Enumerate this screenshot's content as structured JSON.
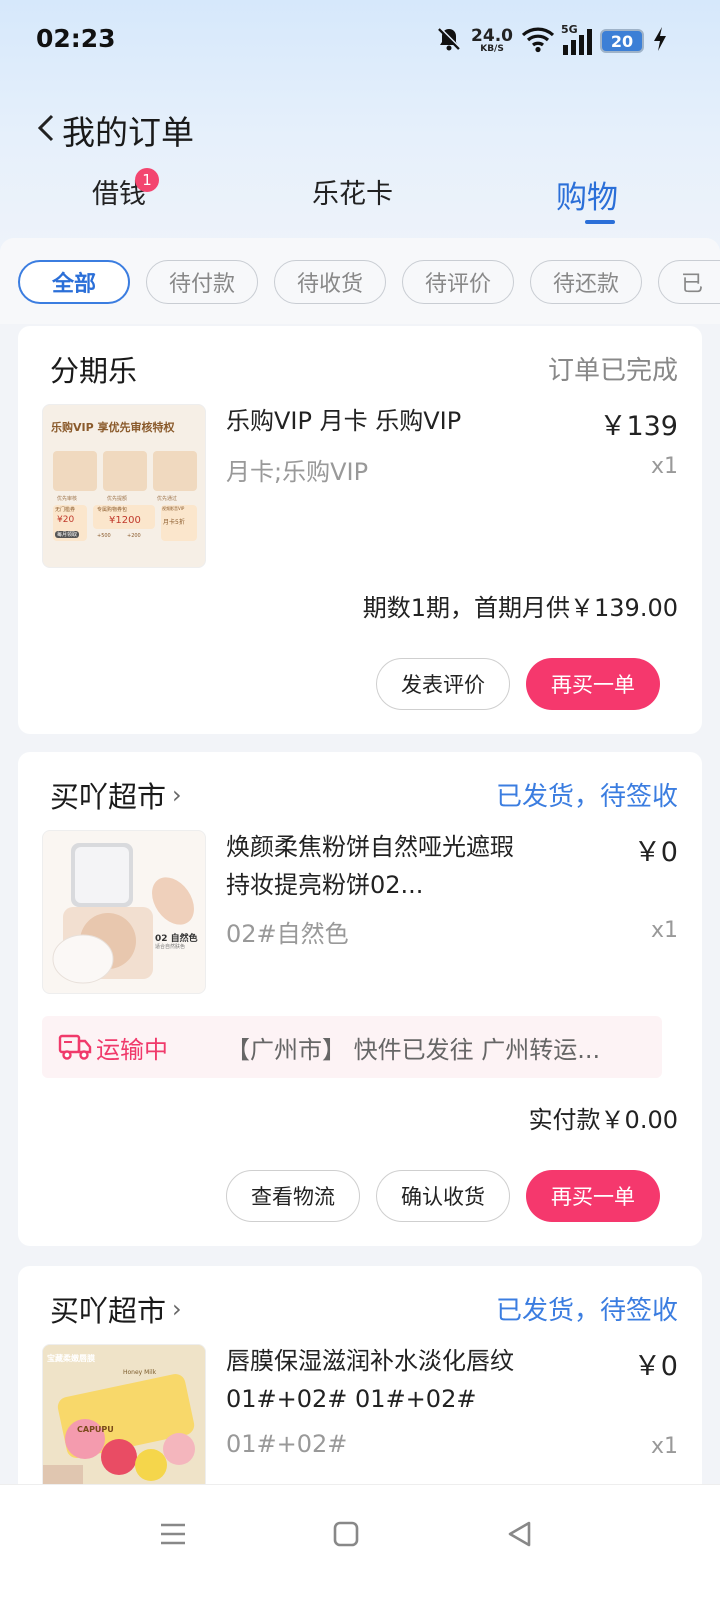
{
  "status_bar": {
    "time": "02:23",
    "net_speed_value": "24.0",
    "net_speed_unit": "KB/S",
    "network": "5G",
    "battery": "20",
    "icons": [
      "mute-bell-icon",
      "wifi-icon",
      "signal-icon",
      "battery-icon",
      "charging-icon"
    ]
  },
  "header": {
    "title": "我的订单"
  },
  "tabs": [
    {
      "label": "借钱",
      "badge": "1"
    },
    {
      "label": "乐花卡"
    },
    {
      "label": "购物",
      "active": true
    }
  ],
  "filters": [
    {
      "label": "全部",
      "active": true
    },
    {
      "label": "待付款"
    },
    {
      "label": "待收货"
    },
    {
      "label": "待评价"
    },
    {
      "label": "待还款"
    },
    {
      "label": "已"
    }
  ],
  "orders": [
    {
      "shop": "分期乐",
      "status": "订单已完成",
      "product_name": "乐购VIP 月卡 乐购VIP",
      "price": "￥139",
      "spec": "月卡;乐购VIP",
      "qty": "x1",
      "summary": "期数1期，首期月供￥139.00",
      "thumb": {
        "title": "乐购VIP 享优先审核特权",
        "f1": "优先审核",
        "f2": "优先提额",
        "f3": "优先通过",
        "b1": "无门槛券",
        "b1v": "¥20",
        "b1b": "每月领取",
        "b2": "专属购物券包",
        "b2v": "¥1200",
        "b2a": "+500",
        "b2b": "+200",
        "b3": "视频影音VIP",
        "b3v": "月卡5折"
      },
      "buttons": [
        "发表评价",
        "再买一单"
      ]
    },
    {
      "shop": "买吖超市",
      "status": "已发货，待签收",
      "product_name": "焕颜柔焦粉饼自然哑光遮瑕持妆提亮粉饼02...",
      "price": "￥0",
      "spec": "02#自然色",
      "qty": "x1",
      "thumb": {
        "label": "02 自然色",
        "sub": "适合自然肤色"
      },
      "logistics_status": "运输中",
      "logistics_text": "【广州市】 快件已发往 广州转运...",
      "summary": "实付款￥0.00",
      "buttons": [
        "查看物流",
        "确认收货",
        "再买一单"
      ]
    },
    {
      "shop": "买吖超市",
      "status": "已发货，待签收",
      "product_name": "唇膜保湿滋润补水淡化唇纹01#+02# 01#+02#",
      "price": "￥0",
      "spec": "01#+02#",
      "qty": "x1",
      "thumb": {
        "title": "宝藏柔嫩唇膜",
        "brand": "CAPUPU",
        "tag": "Honey Milk"
      }
    }
  ],
  "nav": [
    "menu-icon",
    "home-square-icon",
    "back-triangle-icon"
  ]
}
